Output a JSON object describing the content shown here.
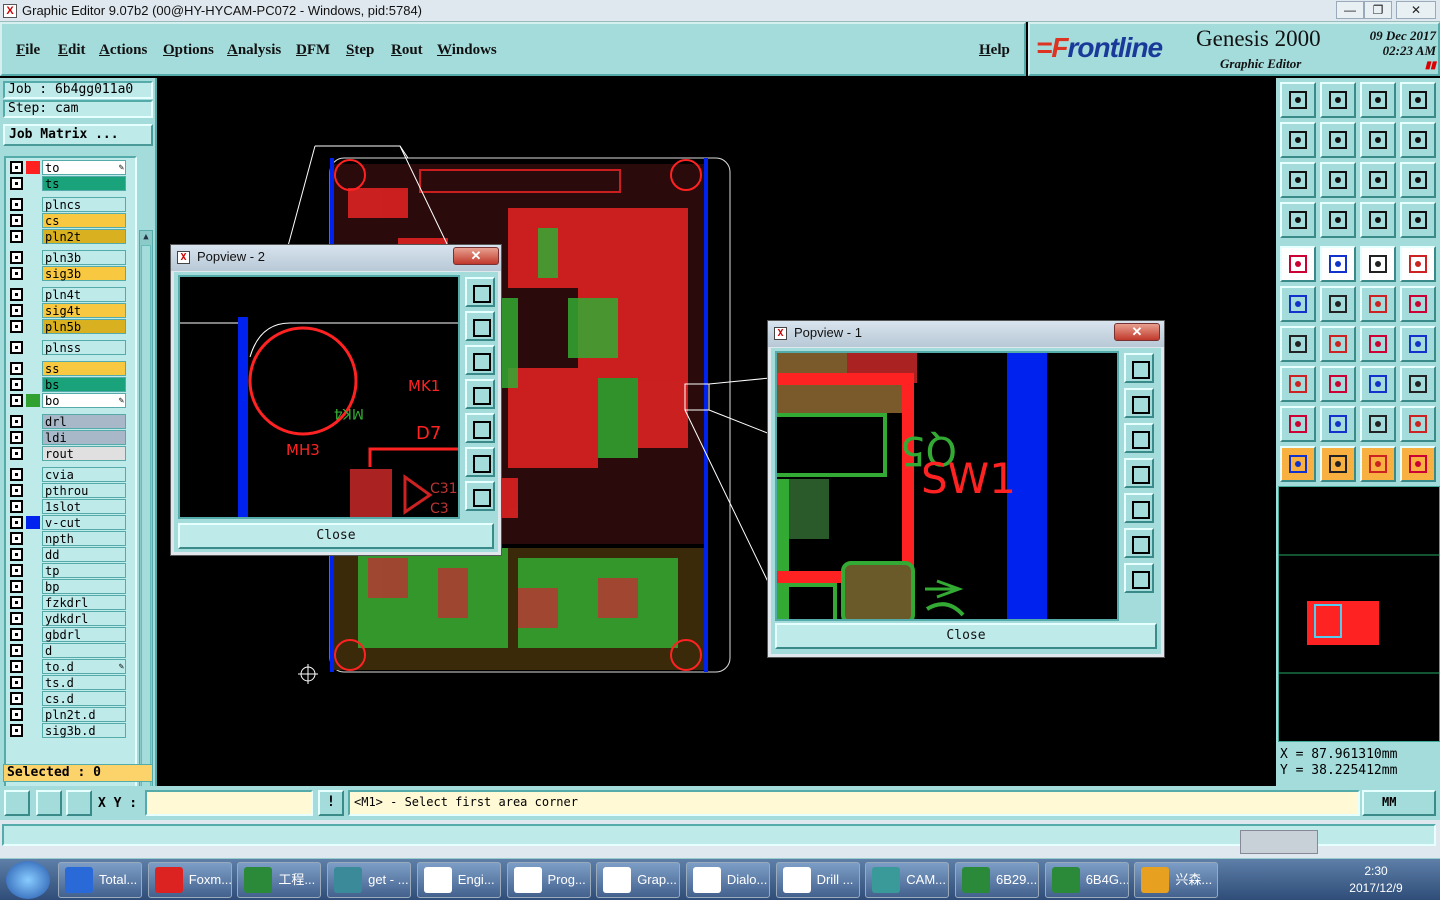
{
  "window": {
    "title": "Graphic Editor 9.07b2 (00@HY-HYCAM-PC072 - Windows, pid:5784)",
    "min": "—",
    "max": "❐",
    "close": "✕"
  },
  "menu": [
    "File",
    "Edit",
    "Actions",
    "Options",
    "Analysis",
    "DFM",
    "Step",
    "Rout",
    "Windows"
  ],
  "help": "Help",
  "brand": {
    "logo_pre": "=F",
    "logo_rest": "rontline",
    "product": "Genesis 2000",
    "mode": "Graphic Editor",
    "date": "09 Dec 2017",
    "time": "02:23 AM"
  },
  "job": {
    "job_line": "Job : 6b4gg011a0",
    "step_line": "Step: cam",
    "matrix_button": "Job Matrix ..."
  },
  "layers": [
    {
      "name": "to",
      "color": "#ffffff",
      "swatch": "#ff2020",
      "edit": true
    },
    {
      "name": "ts",
      "color": "#1aa37a",
      "swatch": "",
      "edit": false
    },
    {
      "name": "plncs",
      "color": "#bfeaea",
      "swatch": "",
      "edit": false
    },
    {
      "name": "cs",
      "color": "#f8c840",
      "swatch": "",
      "edit": false
    },
    {
      "name": "pln2t",
      "color": "#d8b020",
      "swatch": "",
      "edit": false
    },
    {
      "name": "pln3b",
      "color": "#bfeaea",
      "swatch": "",
      "edit": false
    },
    {
      "name": "sig3b",
      "color": "#f8c840",
      "swatch": "",
      "edit": false
    },
    {
      "name": "pln4t",
      "color": "#bfeaea",
      "swatch": "",
      "edit": false
    },
    {
      "name": "sig4t",
      "color": "#f8c840",
      "swatch": "",
      "edit": false
    },
    {
      "name": "pln5b",
      "color": "#d8b020",
      "swatch": "",
      "edit": false
    },
    {
      "name": "plnss",
      "color": "#bfeaea",
      "swatch": "",
      "edit": false
    },
    {
      "name": "ss",
      "color": "#f8c840",
      "swatch": "",
      "edit": false
    },
    {
      "name": "bs",
      "color": "#1aa37a",
      "swatch": "",
      "edit": false
    },
    {
      "name": "bo",
      "color": "#ffffff",
      "swatch": "#30a030",
      "edit": true
    },
    {
      "name": "drl",
      "color": "#a8b8c8",
      "swatch": "",
      "edit": false
    },
    {
      "name": "ldi",
      "color": "#a8b8c8",
      "swatch": "",
      "edit": false
    },
    {
      "name": "rout",
      "color": "#e0e0e0",
      "swatch": "",
      "edit": false
    },
    {
      "name": "cvia",
      "color": "#bfeaea",
      "swatch": "",
      "edit": false
    },
    {
      "name": "pthrou",
      "color": "#bfeaea",
      "swatch": "",
      "edit": false
    },
    {
      "name": "1slot",
      "color": "#bfeaea",
      "swatch": "",
      "edit": false
    },
    {
      "name": "v-cut",
      "color": "#bfeaea",
      "swatch": "#0022ee",
      "edit": false
    },
    {
      "name": "npth",
      "color": "#bfeaea",
      "swatch": "",
      "edit": false
    },
    {
      "name": "dd",
      "color": "#bfeaea",
      "swatch": "",
      "edit": false
    },
    {
      "name": "tp",
      "color": "#bfeaea",
      "swatch": "",
      "edit": false
    },
    {
      "name": "bp",
      "color": "#bfeaea",
      "swatch": "",
      "edit": false
    },
    {
      "name": "fzkdrl",
      "color": "#bfeaea",
      "swatch": "",
      "edit": false
    },
    {
      "name": "ydkdrl",
      "color": "#bfeaea",
      "swatch": "",
      "edit": false
    },
    {
      "name": "gbdrl",
      "color": "#bfeaea",
      "swatch": "",
      "edit": false
    },
    {
      "name": "d",
      "color": "#bfeaea",
      "swatch": "",
      "edit": false
    },
    {
      "name": "to.d",
      "color": "#bfeaea",
      "swatch": "",
      "edit": true
    },
    {
      "name": "ts.d",
      "color": "#bfeaea",
      "swatch": "",
      "edit": false
    },
    {
      "name": "cs.d",
      "color": "#bfeaea",
      "swatch": "",
      "edit": false
    },
    {
      "name": "pln2t.d",
      "color": "#bfeaea",
      "swatch": "",
      "edit": false
    },
    {
      "name": "sig3b.d",
      "color": "#bfeaea",
      "swatch": "",
      "edit": false
    }
  ],
  "selected": "Selected : 0",
  "popview2": {
    "title": "Popview - 2",
    "close_x": "✕",
    "close": "Close",
    "labels": {
      "mk1": "MK1",
      "mk4": "MK4",
      "d7": "D7",
      "mh3": "MH3",
      "c31": "C31",
      "c3": "C3"
    }
  },
  "popview1": {
    "title": "Popview - 1",
    "close_x": "✕",
    "close": "Close",
    "labels": {
      "sw1": "SW1",
      "q5": "Q5"
    }
  },
  "coords": {
    "x": "X = 87.961310mm",
    "y": "Y = 38.225412mm"
  },
  "status": {
    "xy_label": "X Y :",
    "xy_value": "",
    "prompt": "<M1> - Select first area corner",
    "units": "MM",
    "bang": "!"
  },
  "taskbar": {
    "items": [
      "Total...",
      "Foxm...",
      "工程...",
      "get - ...",
      "Engi...",
      "Prog...",
      "Grap...",
      "Dialo...",
      "Drill ...",
      "CAM...",
      "6B29...",
      "6B4G...",
      "兴森..."
    ],
    "time": "2:30",
    "date": "2017/12/9"
  },
  "colors": {
    "panel": "#a4dcdc",
    "accent_red": "#ff2020",
    "vcut_blue": "#0022ee"
  }
}
